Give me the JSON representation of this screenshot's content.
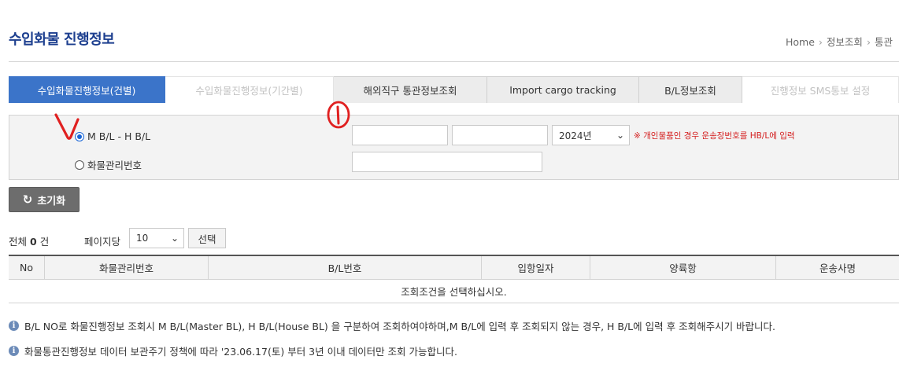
{
  "header": {
    "title": "수입화물 진행정보",
    "breadcrumb": [
      "Home",
      "정보조회",
      "통관"
    ]
  },
  "tabs": [
    {
      "label": "수입화물진행정보(건별)",
      "state": "active"
    },
    {
      "label": "수입화물진행정보(기간별)",
      "state": "disabled"
    },
    {
      "label": "해외직구 통관정보조회",
      "state": "normal"
    },
    {
      "label": "Import cargo tracking",
      "state": "normal"
    },
    {
      "label": "B/L정보조회",
      "state": "normal"
    },
    {
      "label": "진행정보 SMS통보 설정",
      "state": "disabled"
    }
  ],
  "search": {
    "option_bl": "M B/L - H B/L",
    "option_cargo": "화물관리번호",
    "selected": "M B/L - H B/L",
    "mbl_value": "",
    "hbl_value": "",
    "cargo_value": "",
    "year": "2024년",
    "notice": "※ 개인물품인 경우 운송장번호를 HB/L에 입력"
  },
  "reset_label": "초기화",
  "list": {
    "total_label": "전체",
    "total_count": "0",
    "total_unit": "건",
    "per_page_label": "페이지당",
    "per_page_value": "10",
    "select_label": "선택"
  },
  "table": {
    "columns": [
      "No",
      "화물관리번호",
      "B/L번호",
      "입항일자",
      "양륙항",
      "운송사명"
    ],
    "empty_message": "조회조건을 선택하십시오."
  },
  "info": [
    "B/L NO로 화물진행정보 조회시 M B/L(Master BL), H B/L(House BL) 을 구분하여 조회하여야하며,M B/L에 입력 후 조회되지 않는 경우, H B/L에 입력 후 조회해주시기 바랍니다.",
    "화물통관진행정보 데이터 보관주기 정책에 따라 '23.06.17(토) 부터 3년 이내 데이터만 조회 가능합니다."
  ],
  "colors": {
    "accent": "#3b74c9",
    "title": "#1d3f8f",
    "notice": "#d41f1f",
    "annotation": "#e02020"
  }
}
